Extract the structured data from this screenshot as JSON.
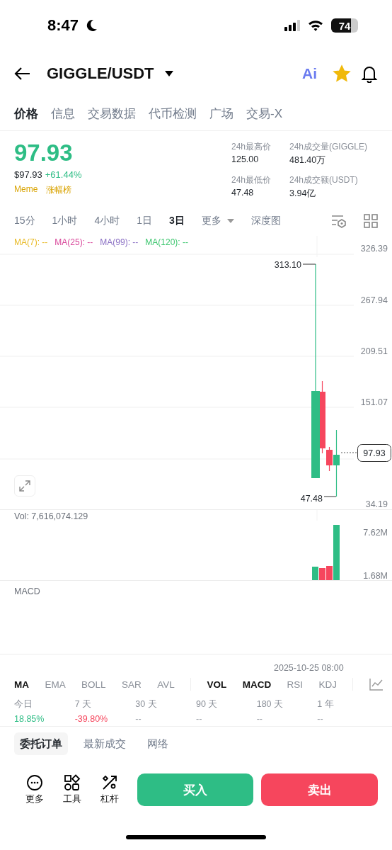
{
  "status_bar": {
    "time": "8:47",
    "battery": "74"
  },
  "header": {
    "pair": "GIGGLE/USDT",
    "ai_label": "Ai",
    "favorite": true
  },
  "tabs": [
    {
      "label": "价格",
      "selected": true
    },
    {
      "label": "信息",
      "selected": false
    },
    {
      "label": "交易数据",
      "selected": false
    },
    {
      "label": "代币检测",
      "selected": false
    },
    {
      "label": "广场",
      "selected": false
    },
    {
      "label": "交易-X",
      "selected": false
    }
  ],
  "ticker": {
    "price": "97.93",
    "usd_price": "$97.93",
    "change": "+61.44%",
    "tags": [
      "Meme",
      "涨幅榜"
    ],
    "stats": [
      {
        "label": "24h最高价",
        "value": "125.00"
      },
      {
        "label": "24h成交量(GIGGLE)",
        "value": "481.40万"
      },
      {
        "label": "24h最低价",
        "value": "47.48"
      },
      {
        "label": "24h成交额(USDT)",
        "value": "3.94亿"
      }
    ]
  },
  "intervals": [
    {
      "label": "15分",
      "kind": "interval",
      "selected": false
    },
    {
      "label": "1小时",
      "kind": "interval",
      "selected": false
    },
    {
      "label": "4小时",
      "kind": "interval",
      "selected": false
    },
    {
      "label": "1日",
      "kind": "interval",
      "selected": false
    },
    {
      "label": "3日",
      "kind": "interval",
      "selected": true
    },
    {
      "label": "更多",
      "kind": "dropdown",
      "selected": false
    },
    {
      "label": "深度图",
      "kind": "interval",
      "selected": false
    }
  ],
  "ma_legend": [
    {
      "label": "MA(7): --",
      "color": "#e8b923"
    },
    {
      "label": "MA(25): --",
      "color": "#d9489b"
    },
    {
      "label": "MA(99): --",
      "color": "#8a6fc4"
    },
    {
      "label": "MA(120): --",
      "color": "#3cc66e"
    }
  ],
  "chart": {
    "y_labels": [
      "326.39",
      "267.94",
      "209.51",
      "151.07",
      "34.19"
    ],
    "high_label": "313.10",
    "low_label": "47.48",
    "last_price": "97.93"
  },
  "volume": {
    "label": "Vol: 7,616,074.129",
    "y_labels": [
      "7.62M",
      "1.68M"
    ]
  },
  "macd": {
    "label": "MACD"
  },
  "time_label": "2025-10-25 08:00",
  "main_indicators": [
    {
      "label": "MA",
      "selected": true
    },
    {
      "label": "EMA",
      "selected": false
    },
    {
      "label": "BOLL",
      "selected": false
    },
    {
      "label": "SAR",
      "selected": false
    },
    {
      "label": "AVL",
      "selected": false
    }
  ],
  "sub_indicators": [
    {
      "label": "VOL",
      "selected": true
    },
    {
      "label": "MACD",
      "selected": true
    },
    {
      "label": "RSI",
      "selected": false
    },
    {
      "label": "KDJ",
      "selected": false
    }
  ],
  "periods": [
    {
      "label": "今日",
      "value": "18.85%",
      "color": "#2ebd85"
    },
    {
      "label": "7 天",
      "value": "-39.80%",
      "color": "#f6465d"
    },
    {
      "label": "30 天",
      "value": "--",
      "color": "#9a9ea6"
    },
    {
      "label": "90 天",
      "value": "--",
      "color": "#9a9ea6"
    },
    {
      "label": "180 天",
      "value": "--",
      "color": "#9a9ea6"
    },
    {
      "label": "1 年",
      "value": "--",
      "color": "#9a9ea6"
    }
  ],
  "order_tabs": [
    {
      "label": "委托订单",
      "selected": true
    },
    {
      "label": "最新成交",
      "selected": false
    },
    {
      "label": "网络",
      "selected": false
    }
  ],
  "actions": [
    {
      "label": "更多",
      "kind": "more"
    },
    {
      "label": "工具",
      "kind": "tools"
    },
    {
      "label": "杠杆",
      "kind": "leverage"
    }
  ],
  "buy": "买入",
  "sell": "卖出"
}
